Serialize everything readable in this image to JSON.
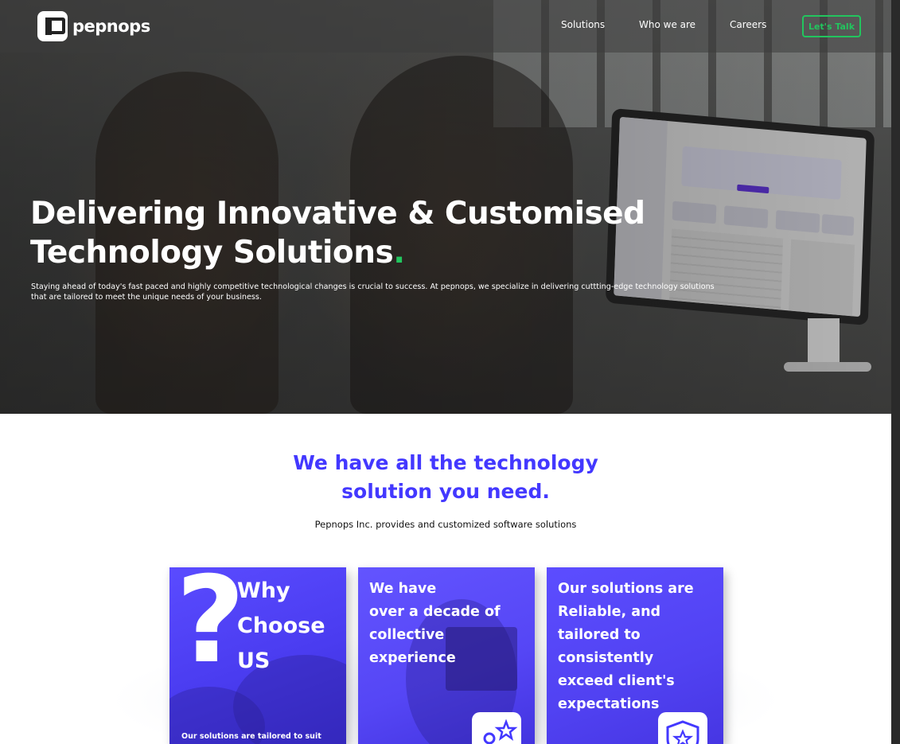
{
  "nav": {
    "logo_text": "pepnops",
    "links": [
      "Solutions",
      "Who we are",
      "Careers"
    ],
    "cta": "Let's Talk"
  },
  "hero": {
    "title": "Delivering Innovative & Customised Technology Solutions",
    "title_dot": ".",
    "description": "Staying ahead of today's fast paced and highly competitive technological changes is crucial to success. At pepnops, we specialize in delivering cuttting-edge technology solutions that are tailored to meet the unique needs of your business."
  },
  "section": {
    "title_line1": "We have all the technology",
    "title_line2": "solution you need.",
    "subtitle": "Pepnops Inc. provides and customized software solutions"
  },
  "cards": [
    {
      "mark": "?",
      "heading": [
        "Why",
        "Choose",
        "US"
      ],
      "footer": "Our solutions are tailored to suit"
    },
    {
      "heading": [
        "We have",
        "over a decade of",
        "collective",
        "experience"
      ],
      "icon": "user-star-icon"
    },
    {
      "heading": [
        "Our solutions are",
        "Reliable, and",
        "tailored to",
        "consistently",
        "exceed client's",
        "expectations"
      ],
      "icon": "shield-star-icon"
    }
  ],
  "colors": {
    "brand": "#4338ff",
    "accent_green": "#22c55e",
    "card_purple": "#5546f5"
  }
}
